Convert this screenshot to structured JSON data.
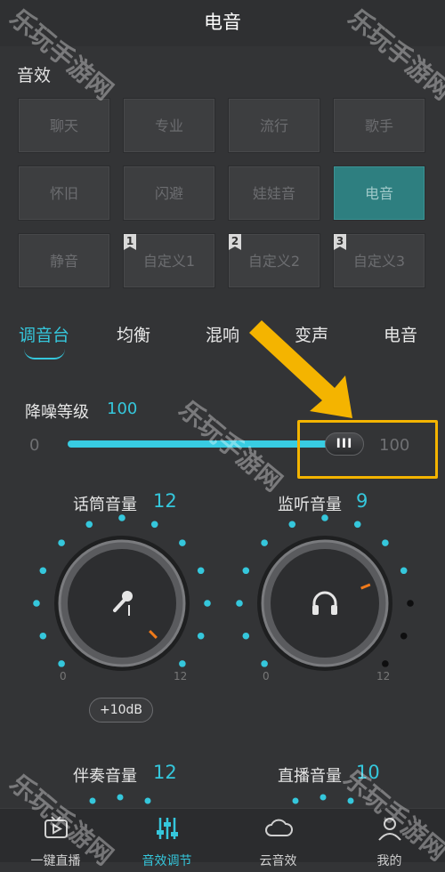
{
  "header": {
    "title": "电音"
  },
  "effects": {
    "section_label": "音效",
    "buttons": [
      {
        "label": "聊天",
        "active": false
      },
      {
        "label": "专业",
        "active": false
      },
      {
        "label": "流行",
        "active": false
      },
      {
        "label": "歌手",
        "active": false
      },
      {
        "label": "怀旧",
        "active": false
      },
      {
        "label": "闪避",
        "active": false
      },
      {
        "label": "娃娃音",
        "active": false
      },
      {
        "label": "电音",
        "active": true
      },
      {
        "label": "静音",
        "active": false
      },
      {
        "label": "自定义1",
        "active": false,
        "flag": "1"
      },
      {
        "label": "自定义2",
        "active": false,
        "flag": "2"
      },
      {
        "label": "自定义3",
        "active": false,
        "flag": "3"
      }
    ]
  },
  "tabs": [
    {
      "label": "调音台",
      "active": true
    },
    {
      "label": "均衡",
      "active": false
    },
    {
      "label": "混响",
      "active": false
    },
    {
      "label": "变声",
      "active": false
    },
    {
      "label": "电音",
      "active": false
    }
  ],
  "noise": {
    "label": "降噪等级",
    "value": "100",
    "min": "0",
    "max": "100",
    "level": 1.0,
    "thumb_glyph": "III"
  },
  "knobs": [
    {
      "label": "话筒音量",
      "value": "12",
      "min": "0",
      "max": "12",
      "icon": "microphone-icon",
      "level": 1.0
    },
    {
      "label": "监听音量",
      "value": "9",
      "min": "0",
      "max": "12",
      "icon": "headphones-icon",
      "level": 0.75
    },
    {
      "label": "伴奏音量",
      "value": "12"
    },
    {
      "label": "直播音量",
      "value": "10"
    }
  ],
  "db_button": "+10dB",
  "bottom_nav": [
    {
      "label": "一键直播",
      "icon": "tv-play-icon",
      "active": false
    },
    {
      "label": "音效调节",
      "icon": "equalizer-icon",
      "active": true
    },
    {
      "label": "云音效",
      "icon": "cloud-icon",
      "active": false
    },
    {
      "label": "我的",
      "icon": "user-icon",
      "active": false
    }
  ],
  "watermark": "乐玩手游网",
  "colors": {
    "accent": "#35c7dc",
    "active_button": "#2e7f80",
    "highlight": "#f4b400",
    "background": "#333436"
  }
}
